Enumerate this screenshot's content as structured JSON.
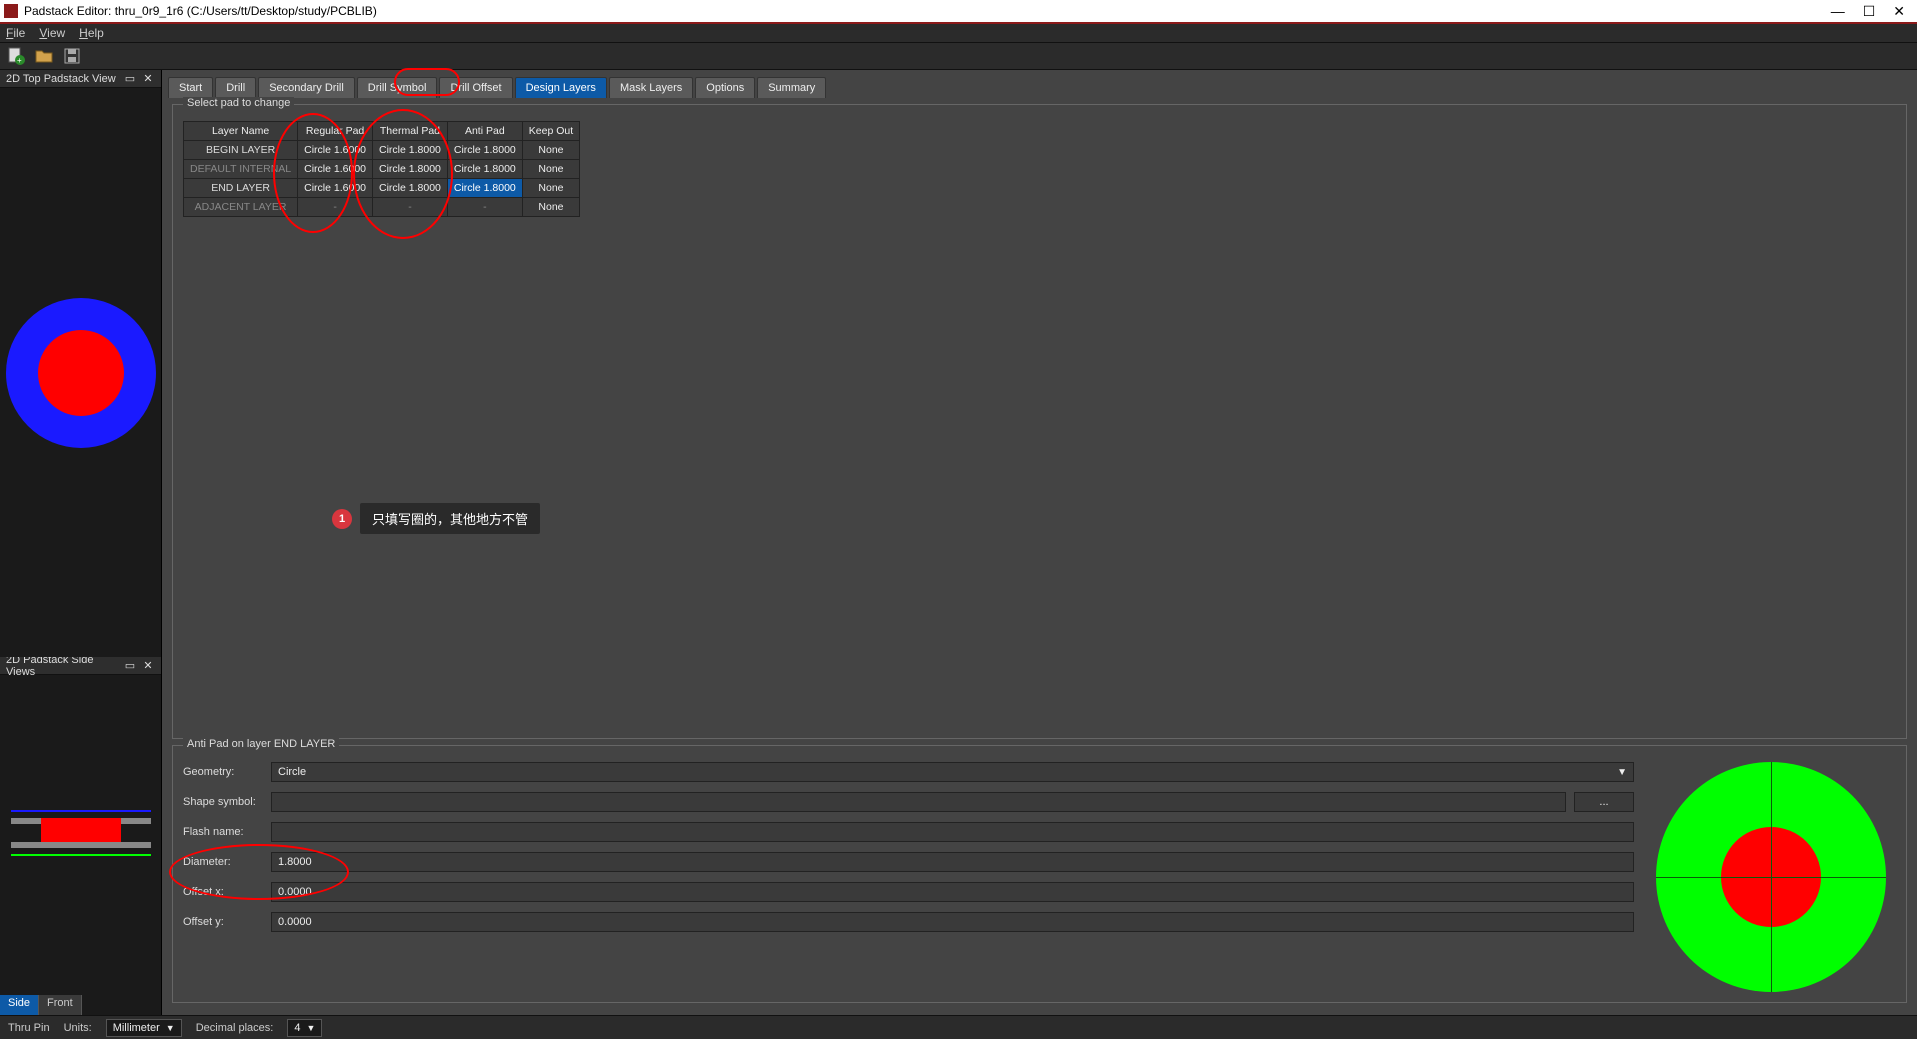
{
  "window": {
    "title": "Padstack Editor: thru_0r9_1r6  (C:/Users/tt/Desktop/study/PCBLIB)",
    "min": "—",
    "max": "☐",
    "close": "✕"
  },
  "menu": {
    "file": "File",
    "view": "View",
    "help": "Help"
  },
  "left": {
    "top_title": "2D Top Padstack View",
    "side_title": "2D Padstack Side Views",
    "side_btn": "Side",
    "front_btn": "Front"
  },
  "tabs": {
    "items": [
      "Start",
      "Drill",
      "Secondary Drill",
      "Drill Symbol",
      "Drill Offset",
      "Design Layers",
      "Mask Layers",
      "Options",
      "Summary"
    ],
    "active": "Design Layers"
  },
  "grid": {
    "title": "Select pad to change",
    "headers": [
      "Layer Name",
      "Regular Pad",
      "Thermal Pad",
      "Anti Pad",
      "Keep Out"
    ],
    "rows": [
      {
        "name": "BEGIN LAYER",
        "reg": "Circle 1.6000",
        "th": "Circle 1.8000",
        "anti": "Circle 1.8000",
        "ko": "None",
        "dim": false,
        "sel": ""
      },
      {
        "name": "DEFAULT INTERNAL",
        "reg": "Circle 1.6000",
        "th": "Circle 1.8000",
        "anti": "Circle 1.8000",
        "ko": "None",
        "dim": true,
        "sel": ""
      },
      {
        "name": "END LAYER",
        "reg": "Circle 1.6000",
        "th": "Circle 1.8000",
        "anti": "Circle 1.8000",
        "ko": "None",
        "dim": false,
        "sel": "anti"
      },
      {
        "name": "ADJACENT LAYER",
        "reg": "-",
        "th": "-",
        "anti": "-",
        "ko": "None",
        "dim": true,
        "sel": ""
      }
    ]
  },
  "note": {
    "num": "1",
    "text": "只填写圈的，其他地方不管"
  },
  "edit": {
    "title": "Anti Pad on layer END LAYER",
    "geometry_label": "Geometry:",
    "geometry_value": "Circle",
    "shape_label": "Shape symbol:",
    "shape_value": "",
    "browse": "...",
    "flash_label": "Flash name:",
    "flash_value": "",
    "diameter_label": "Diameter:",
    "diameter_value": "1.8000",
    "offx_label": "Offset x:",
    "offx_value": "0.0000",
    "offy_label": "Offset y:",
    "offy_value": "0.0000"
  },
  "status": {
    "thru": "Thru Pin",
    "units_label": "Units:",
    "units_value": "Millimeter",
    "dec_label": "Decimal places:",
    "dec_value": "4"
  }
}
